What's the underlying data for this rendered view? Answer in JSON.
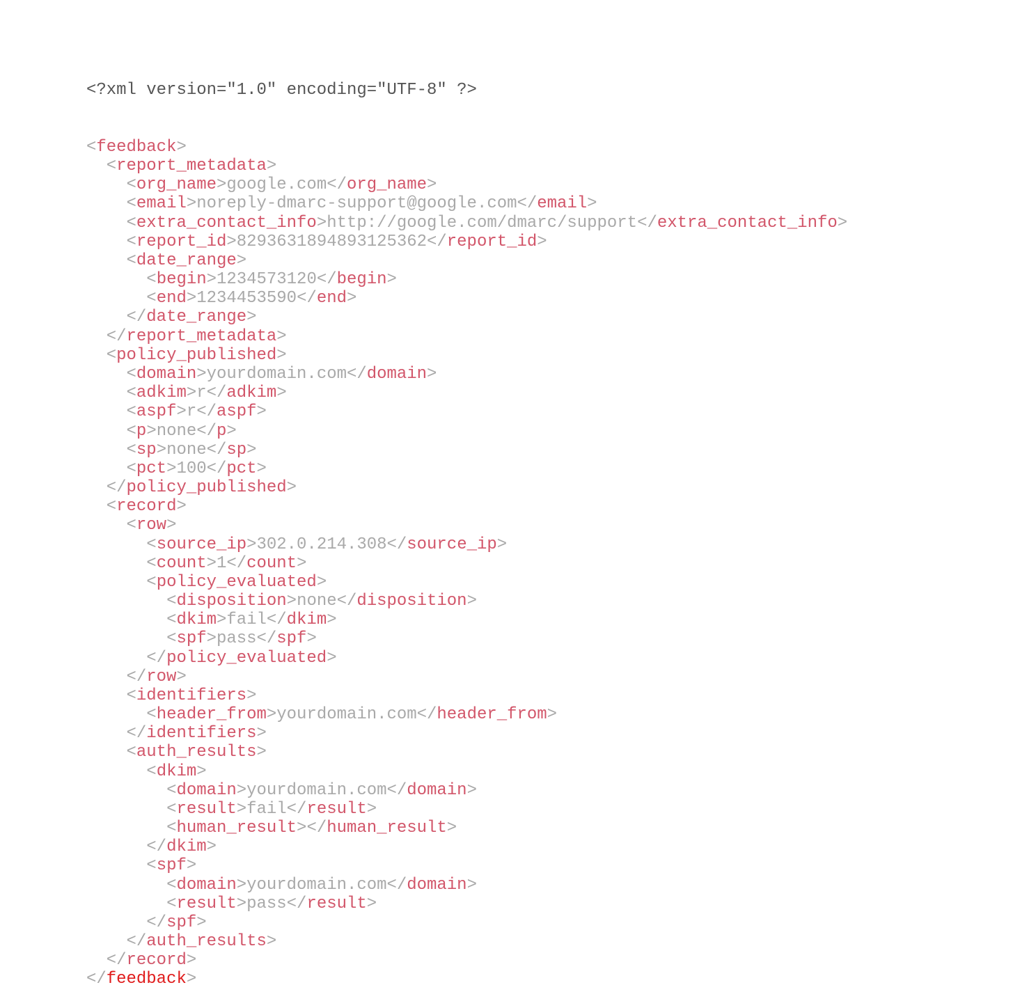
{
  "document": {
    "declaration": "<?xml version=\"1.0\" encoding=\"UTF-8\" ?>",
    "lines": [
      {
        "indent": 0,
        "kind": "open",
        "tag": "feedback"
      },
      {
        "indent": 1,
        "kind": "open",
        "tag": "report_metadata"
      },
      {
        "indent": 2,
        "kind": "leaf",
        "tag": "org_name",
        "value": "google.com"
      },
      {
        "indent": 2,
        "kind": "leaf",
        "tag": "email",
        "value": "noreply-dmarc-support@google.com"
      },
      {
        "indent": 2,
        "kind": "leaf",
        "tag": "extra_contact_info",
        "value": "http://google.com/dmarc/support"
      },
      {
        "indent": 2,
        "kind": "leaf",
        "tag": "report_id",
        "value": "8293631894893125362"
      },
      {
        "indent": 2,
        "kind": "open",
        "tag": "date_range"
      },
      {
        "indent": 3,
        "kind": "leaf",
        "tag": "begin",
        "value": "1234573120"
      },
      {
        "indent": 3,
        "kind": "leaf",
        "tag": "end",
        "value": "1234453590"
      },
      {
        "indent": 2,
        "kind": "close",
        "tag": "date_range"
      },
      {
        "indent": 1,
        "kind": "close",
        "tag": "report_metadata"
      },
      {
        "indent": 1,
        "kind": "open",
        "tag": "policy_published"
      },
      {
        "indent": 2,
        "kind": "leaf",
        "tag": "domain",
        "value": "yourdomain.com"
      },
      {
        "indent": 2,
        "kind": "leaf",
        "tag": "adkim",
        "value": "r"
      },
      {
        "indent": 2,
        "kind": "leaf",
        "tag": "aspf",
        "value": "r"
      },
      {
        "indent": 2,
        "kind": "leaf",
        "tag": "p",
        "value": "none"
      },
      {
        "indent": 2,
        "kind": "leaf",
        "tag": "sp",
        "value": "none"
      },
      {
        "indent": 2,
        "kind": "leaf",
        "tag": "pct",
        "value": "100"
      },
      {
        "indent": 1,
        "kind": "close",
        "tag": "policy_published"
      },
      {
        "indent": 1,
        "kind": "open",
        "tag": "record"
      },
      {
        "indent": 2,
        "kind": "open",
        "tag": "row"
      },
      {
        "indent": 3,
        "kind": "leaf",
        "tag": "source_ip",
        "value": "302.0.214.308"
      },
      {
        "indent": 3,
        "kind": "leaf",
        "tag": "count",
        "value": "1"
      },
      {
        "indent": 3,
        "kind": "open",
        "tag": "policy_evaluated"
      },
      {
        "indent": 4,
        "kind": "leaf",
        "tag": "disposition",
        "value": "none"
      },
      {
        "indent": 4,
        "kind": "leaf",
        "tag": "dkim",
        "value": "fail"
      },
      {
        "indent": 4,
        "kind": "leaf",
        "tag": "spf",
        "value": "pass"
      },
      {
        "indent": 3,
        "kind": "close",
        "tag": "policy_evaluated"
      },
      {
        "indent": 2,
        "kind": "close",
        "tag": "row"
      },
      {
        "indent": 2,
        "kind": "open",
        "tag": "identifiers"
      },
      {
        "indent": 3,
        "kind": "leaf",
        "tag": "header_from",
        "value": "yourdomain.com"
      },
      {
        "indent": 2,
        "kind": "close",
        "tag": "identifiers"
      },
      {
        "indent": 2,
        "kind": "open",
        "tag": "auth_results"
      },
      {
        "indent": 3,
        "kind": "open",
        "tag": "dkim"
      },
      {
        "indent": 4,
        "kind": "leaf",
        "tag": "domain",
        "value": "yourdomain.com"
      },
      {
        "indent": 4,
        "kind": "leaf",
        "tag": "result",
        "value": "fail"
      },
      {
        "indent": 4,
        "kind": "leaf",
        "tag": "human_result",
        "value": ""
      },
      {
        "indent": 3,
        "kind": "close",
        "tag": "dkim"
      },
      {
        "indent": 3,
        "kind": "open",
        "tag": "spf"
      },
      {
        "indent": 4,
        "kind": "leaf",
        "tag": "domain",
        "value": "yourdomain.com"
      },
      {
        "indent": 4,
        "kind": "leaf",
        "tag": "result",
        "value": "pass"
      },
      {
        "indent": 3,
        "kind": "close",
        "tag": "spf"
      },
      {
        "indent": 2,
        "kind": "close",
        "tag": "auth_results"
      },
      {
        "indent": 1,
        "kind": "close",
        "tag": "record"
      },
      {
        "indent": 0,
        "kind": "close",
        "tag": "feedback",
        "emphasis": true
      }
    ]
  },
  "colors": {
    "tag_name": "#d2566a",
    "root_close_tag": "#e01c1c",
    "punctuation": "#a8a8a8",
    "value_text": "#a9a9a9",
    "declaration": "#555555",
    "background": "#ffffff"
  }
}
